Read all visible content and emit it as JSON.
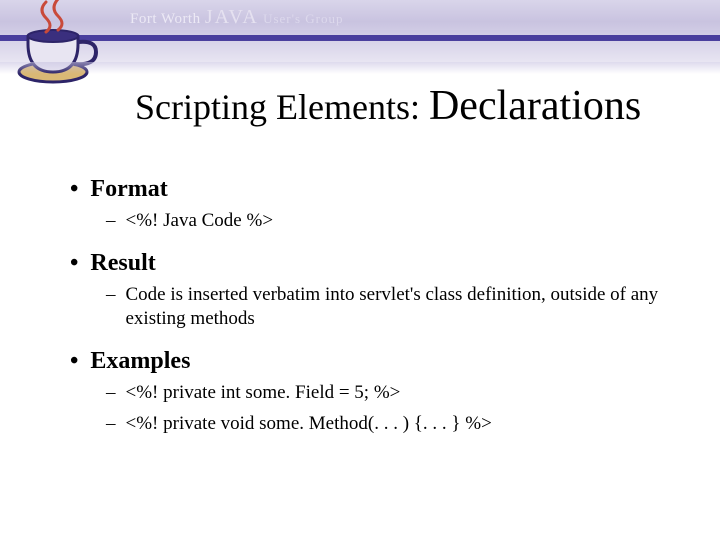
{
  "header": {
    "org_prefix": "Fort Worth",
    "org_java": "JAVA",
    "org_suffix": "User's Group"
  },
  "title": {
    "part1": "Scripting Elements: ",
    "part2": "Declarations"
  },
  "sections": [
    {
      "heading": "Format",
      "items": [
        "<%! Java Code %>"
      ]
    },
    {
      "heading": "Result",
      "items": [
        "Code is inserted verbatim into servlet's class definition, outside of any existing methods"
      ]
    },
    {
      "heading": "Examples",
      "items": [
        "<%! private int some. Field = 5; %>",
        "<%! private void some. Method(. . . ) {. . . } %>"
      ]
    }
  ]
}
